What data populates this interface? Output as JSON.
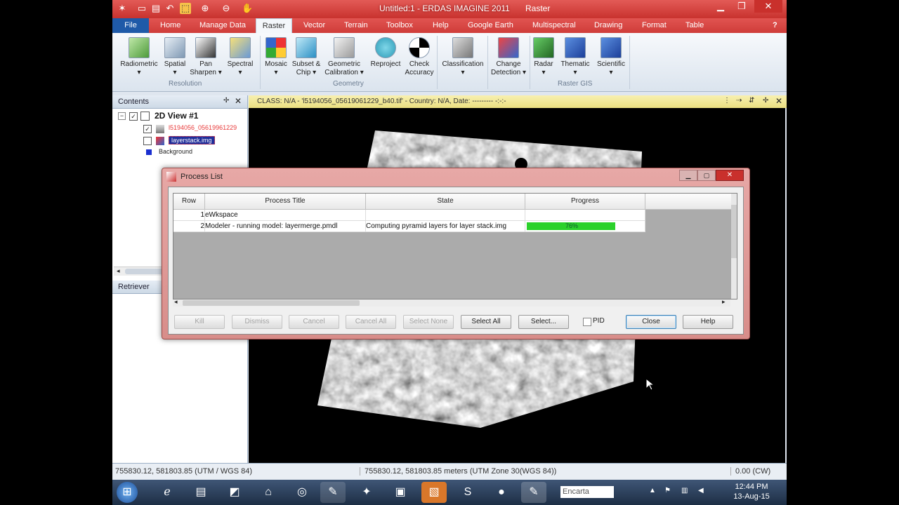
{
  "window": {
    "title": "Untitled:1 - ERDAS IMAGINE 2011",
    "context_tab": "Raster"
  },
  "tabs": [
    "File",
    "Home",
    "Manage Data",
    "Raster",
    "Vector",
    "Terrain",
    "Toolbox",
    "Help",
    "Google Earth",
    "Multispectral",
    "Drawing",
    "Format",
    "Table"
  ],
  "ribbon": {
    "resolution": {
      "label": "Resolution",
      "buttons": [
        "Radiometric",
        "Spatial",
        "Pan Sharpen",
        "Spectral"
      ]
    },
    "geometry": {
      "label": "Geometry",
      "buttons": [
        "Mosaic",
        "Subset & Chip",
        "Geometric Calibration",
        "Reproject",
        "Check Accuracy"
      ]
    },
    "classification": "Classification",
    "change_detection": "Change Detection",
    "raster_gis": {
      "label": "Raster GIS",
      "buttons": [
        "Radar",
        "Thematic",
        "Scientific"
      ]
    }
  },
  "contents": {
    "title": "Contents",
    "view": "2D View #1",
    "layer1": "l5194056_05619961229",
    "layer2": "layerstack.img",
    "background": "Background"
  },
  "retriever": {
    "title": "Retriever"
  },
  "view_header": "CLASS: N/A - 'l5194056_05619061229_b40.tif' - Country: N/A, Date: --------- -:-:-",
  "dialog": {
    "title": "Process List",
    "columns": [
      "Row",
      "Process Title",
      "State",
      "Progress"
    ],
    "rows": [
      {
        "row": "1",
        "title": "eWkspace",
        "state": "",
        "progress": ""
      },
      {
        "row": "2",
        "title": "Modeler - running model: layermerge.pmdl",
        "state": "Computing pyramid layers for layer stack.img",
        "progress": "76%"
      }
    ],
    "progress_fraction": 0.76,
    "buttons": {
      "kill": "Kill",
      "dismiss": "Dismiss",
      "cancel": "Cancel",
      "cancel_all": "Cancel All",
      "select_none": "Select None",
      "select_all": "Select All",
      "select": "Select...",
      "pid": "PID",
      "close": "Close",
      "help": "Help"
    }
  },
  "status": {
    "left": "755830.12, 581803.85  (UTM / WGS 84)",
    "middle": "755830.12, 581803.85 meters (UTM Zone 30(WGS 84))",
    "right": "0.00 (CW)"
  },
  "taskbar": {
    "search": "Encarta",
    "time": "12:44 PM",
    "date": "13-Aug-15"
  },
  "colors": {
    "accent": "#d8403c",
    "progress": "#2bd12b",
    "highlight": "#1f2e9a"
  }
}
